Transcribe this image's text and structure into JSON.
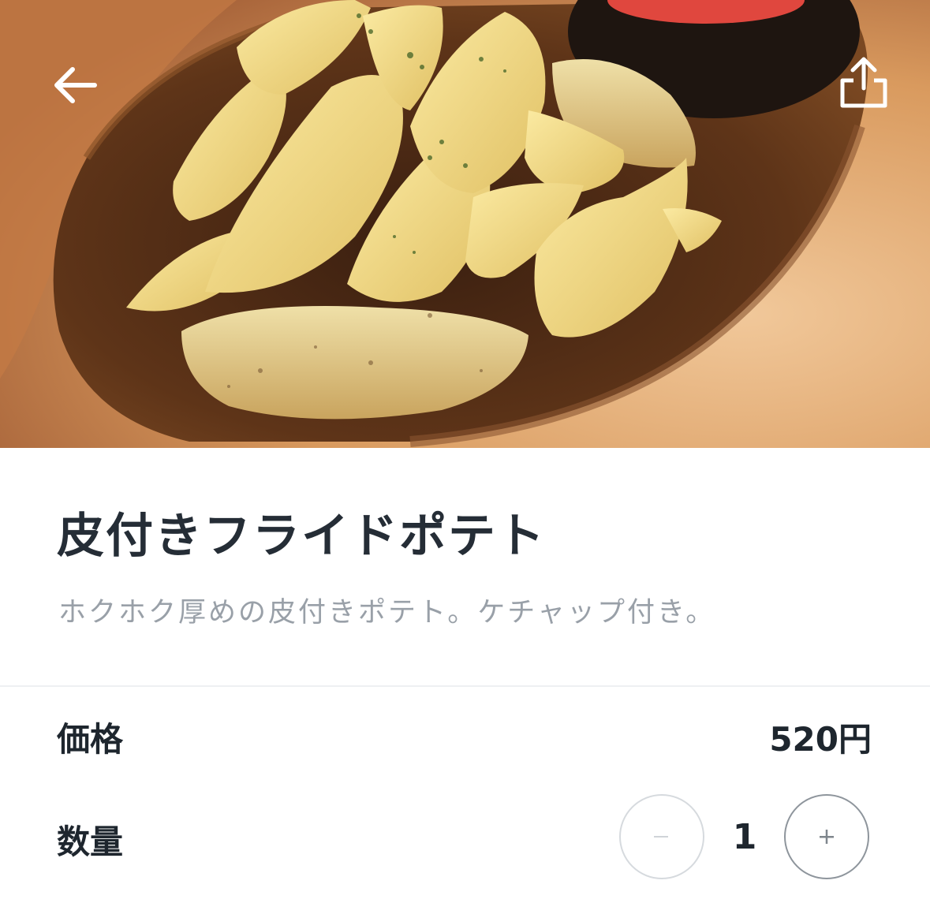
{
  "header": {
    "back_icon": "arrow-left-icon",
    "share_icon": "share-icon",
    "icon_color": "#ffffff"
  },
  "product": {
    "name": "皮付きフライドポテト",
    "description": "ホクホク厚めの皮付きポテト。ケチャップ付き。"
  },
  "price": {
    "label": "価格",
    "value": "520円"
  },
  "quantity": {
    "label": "数量",
    "value": "1",
    "decrement_icon": "minus-icon",
    "increment_icon": "plus-icon"
  },
  "colors": {
    "title_text": "#252d36",
    "description_text": "#99a0a8",
    "divider": "#eef0f2"
  }
}
